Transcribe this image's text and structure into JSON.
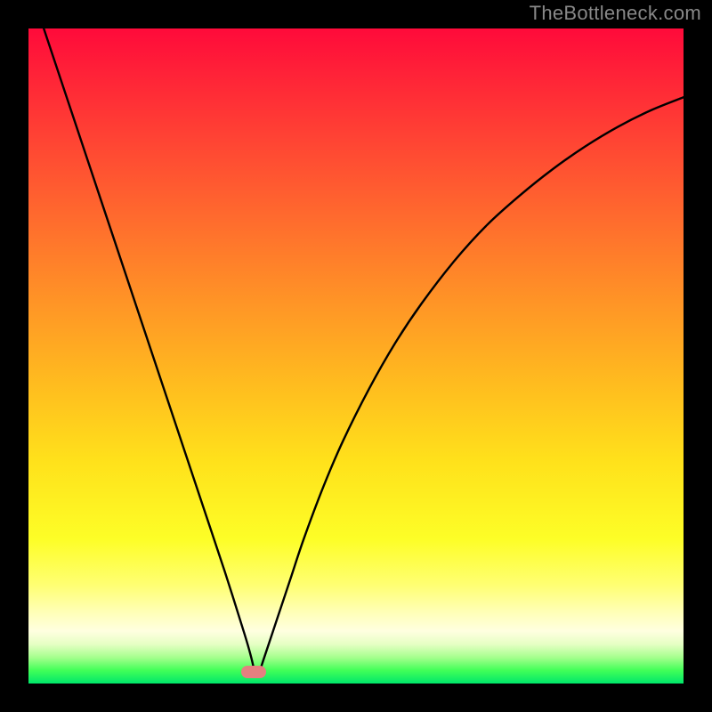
{
  "watermark": "TheBottleneck.com",
  "colors": {
    "frame_bg": "#000000",
    "gradient_top": "#ff0a3a",
    "gradient_bottom": "#00e66a",
    "curve_stroke": "#000000",
    "marker_fill": "#e58080",
    "watermark_text": "#888888"
  },
  "chart_data": {
    "type": "line",
    "title": "",
    "xlabel": "",
    "ylabel": "",
    "xlim": [
      0,
      100
    ],
    "ylim": [
      0,
      100
    ],
    "grid": false,
    "legend": false,
    "x": [
      0,
      3,
      6,
      9,
      12,
      15,
      18,
      21,
      24,
      27,
      30,
      33,
      34,
      34.5,
      35,
      36,
      38,
      40,
      42,
      45,
      48,
      52,
      56,
      60,
      65,
      70,
      75,
      80,
      85,
      90,
      95,
      100
    ],
    "y": [
      107,
      98,
      89,
      80,
      71,
      62,
      53,
      44,
      35,
      26,
      17,
      7.5,
      4,
      1.8,
      1.2,
      4,
      10,
      16,
      22,
      30,
      37,
      45,
      52,
      58,
      64.5,
      70,
      74.5,
      78.5,
      82,
      85,
      87.5,
      89.5
    ],
    "notch": {
      "x": 34.5,
      "y": 1.6
    },
    "marker": {
      "x": 34.4,
      "y": 1.7
    },
    "background_gradient_stops": [
      {
        "pos": 0.0,
        "color": "#ff0a3a"
      },
      {
        "pos": 0.18,
        "color": "#ff4733"
      },
      {
        "pos": 0.42,
        "color": "#ff9526"
      },
      {
        "pos": 0.66,
        "color": "#ffe11b"
      },
      {
        "pos": 0.85,
        "color": "#ffff73"
      },
      {
        "pos": 0.94,
        "color": "#e6ffc4"
      },
      {
        "pos": 1.0,
        "color": "#00e66a"
      }
    ]
  }
}
